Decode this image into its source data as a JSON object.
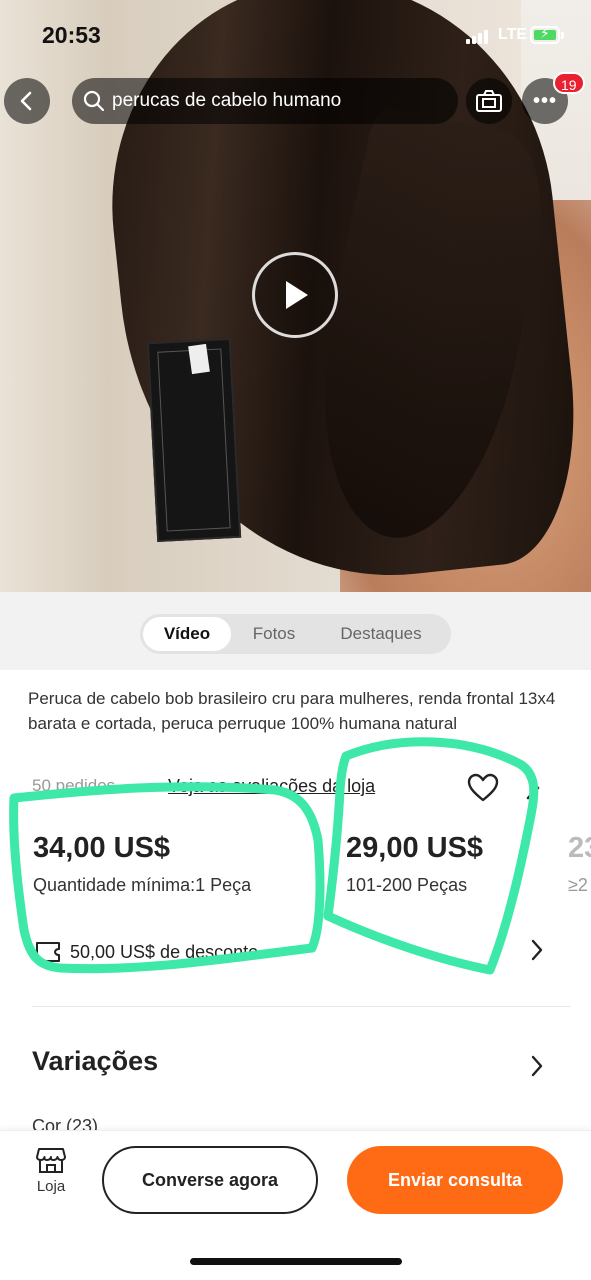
{
  "status_bar": {
    "time": "20:53",
    "network": "LTE"
  },
  "top_nav": {
    "search_text": "perucas de cabelo humano",
    "notification_count": "19",
    "more_label": "•••"
  },
  "media_tabs": [
    {
      "label": "Vídeo",
      "active": true
    },
    {
      "label": "Fotos",
      "active": false
    },
    {
      "label": "Destaques",
      "active": false
    }
  ],
  "product": {
    "title": "Peruca de cabelo bob brasileiro cru para mulheres, renda frontal 13x4 barata e cortada, peruca perruque 100% humana natural",
    "orders": "50 pedidos",
    "reviews_link": "Veja as avaliações da loja",
    "price_tiers": [
      {
        "price": "34,00 US$",
        "quantity": "Quantidade mínima:1 Peça"
      },
      {
        "price": "29,00 US$",
        "quantity": "101-200 Peças"
      },
      {
        "price": "23",
        "quantity": "≥2"
      }
    ],
    "discount": "50,00 US$ de desconto"
  },
  "variations": {
    "title": "Variações",
    "color_label": "Cor (23)"
  },
  "bottom_bar": {
    "store_label": "Loja",
    "chat_label": "Converse agora",
    "inquiry_label": "Enviar consulta"
  },
  "colors": {
    "accent_orange": "#ff6a14",
    "badge_red": "#e8202f",
    "annotation_green": "#3de8a8"
  }
}
